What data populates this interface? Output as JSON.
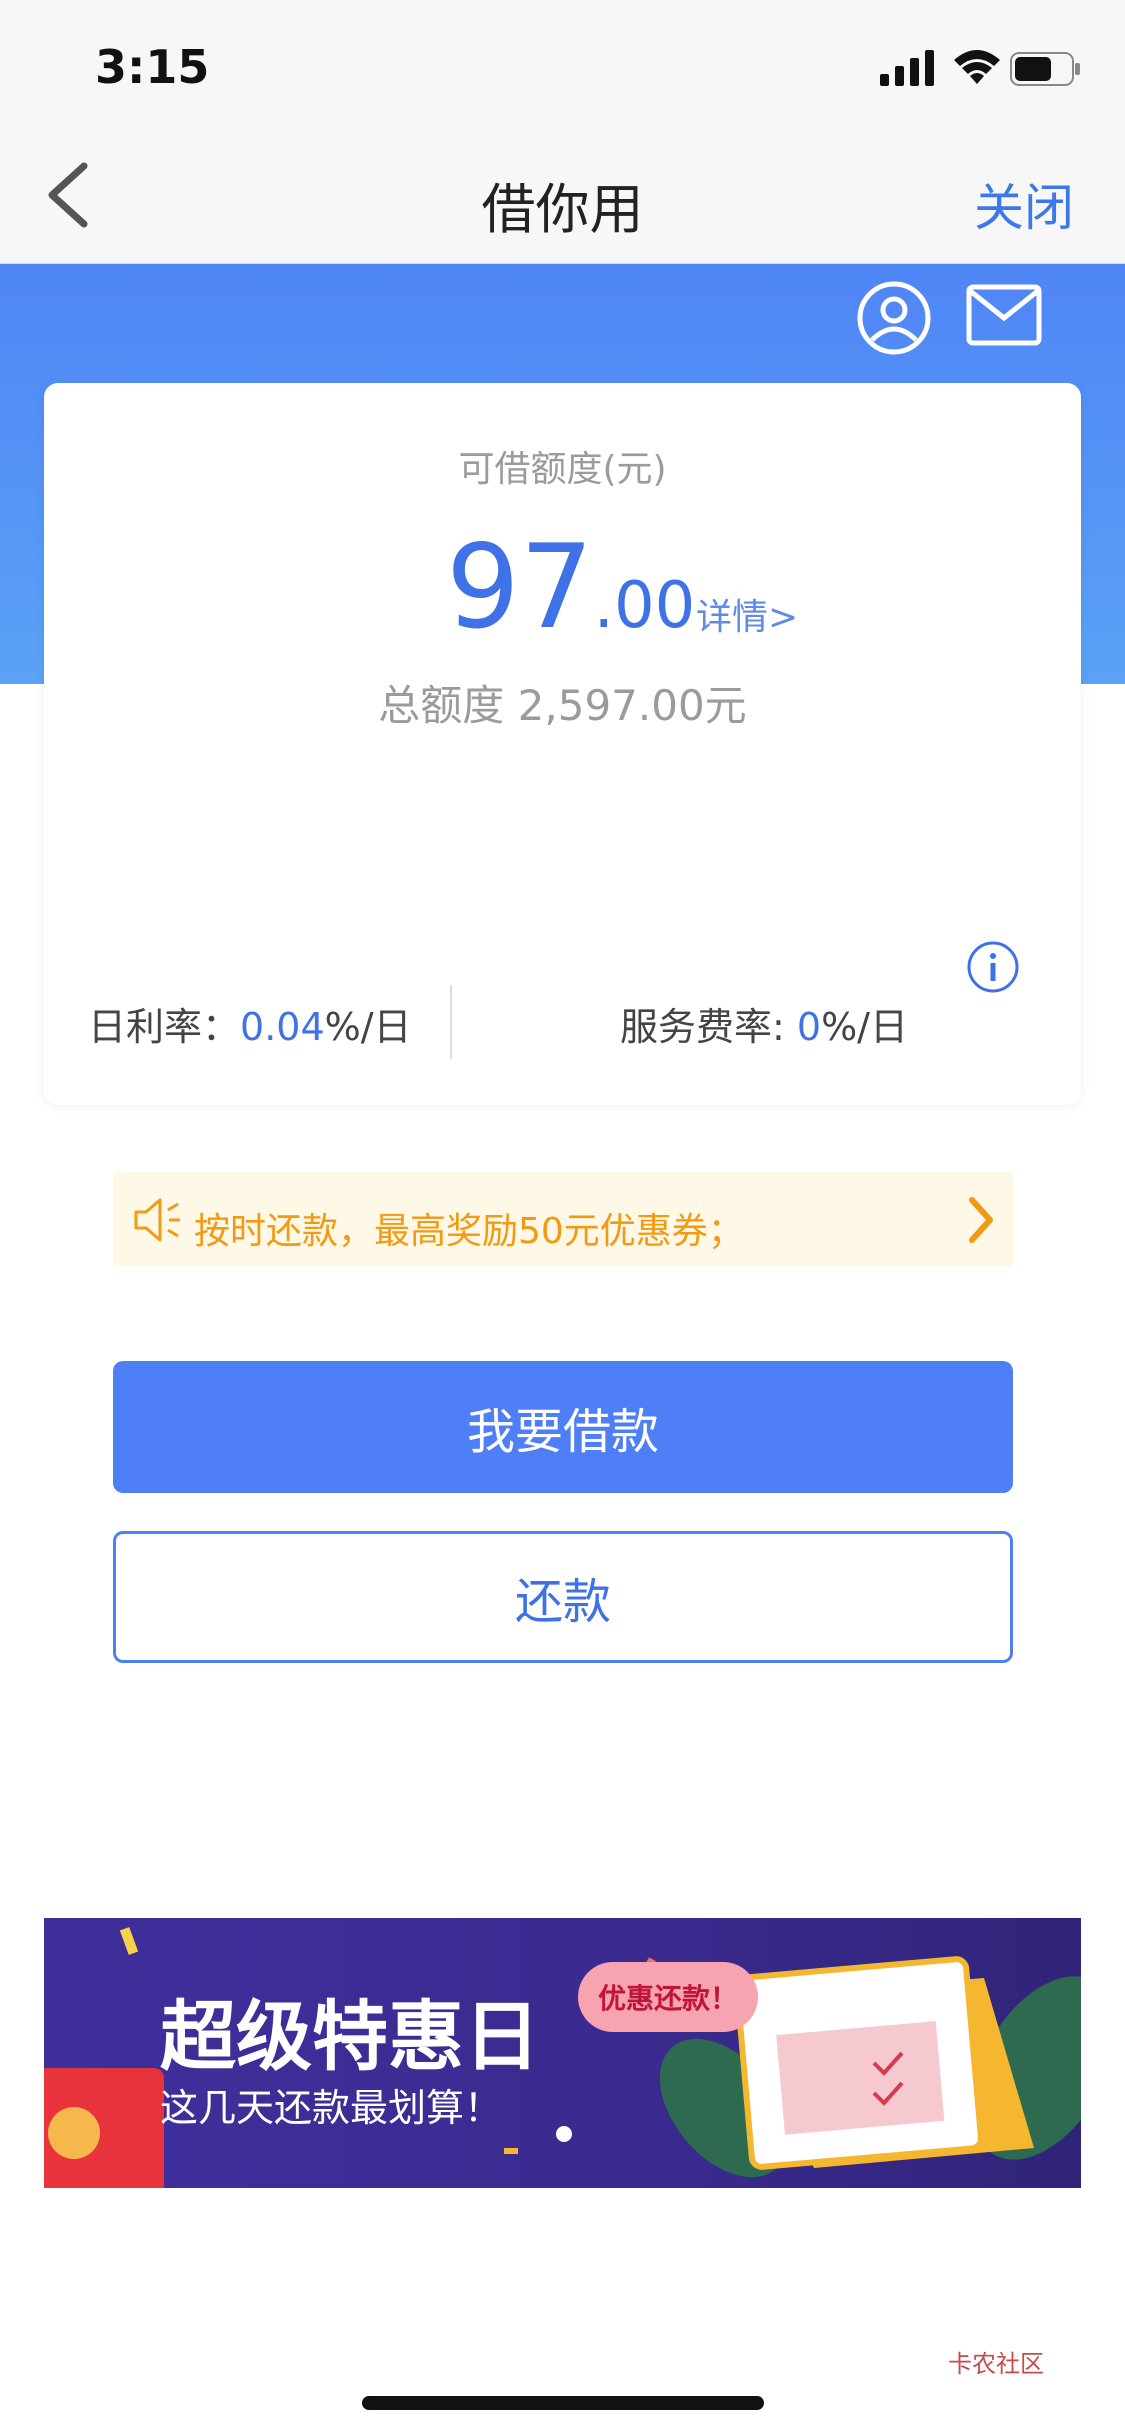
{
  "status_bar": {
    "time": "3:15"
  },
  "nav": {
    "title": "借你用",
    "close_label": "关闭"
  },
  "header_icons": {
    "user": "user-circle-icon",
    "mail": "mail-icon"
  },
  "card": {
    "available_label": "可借额度(元)",
    "available_integer": "97",
    "available_decimal": ".00",
    "detail_link": "详情>",
    "total_label": "总额度 2,597.00元",
    "daily_rate_label": "日利率：",
    "daily_rate_value": "0.04",
    "daily_rate_unit": "%/日",
    "service_fee_label": "服务费率: ",
    "service_fee_value": "0",
    "service_fee_unit": "%/日"
  },
  "notice": {
    "text": "按时还款，最高奖励50元优惠券；"
  },
  "buttons": {
    "borrow": "我要借款",
    "repay": "还款"
  },
  "banner": {
    "title": "超级特惠日",
    "subtitle": "这几天还款最划算！",
    "bubble": "优惠还款！"
  },
  "watermark": "卡农社区",
  "colors": {
    "brand_blue": "#4f7ff7",
    "accent_orange": "#f19a14"
  }
}
